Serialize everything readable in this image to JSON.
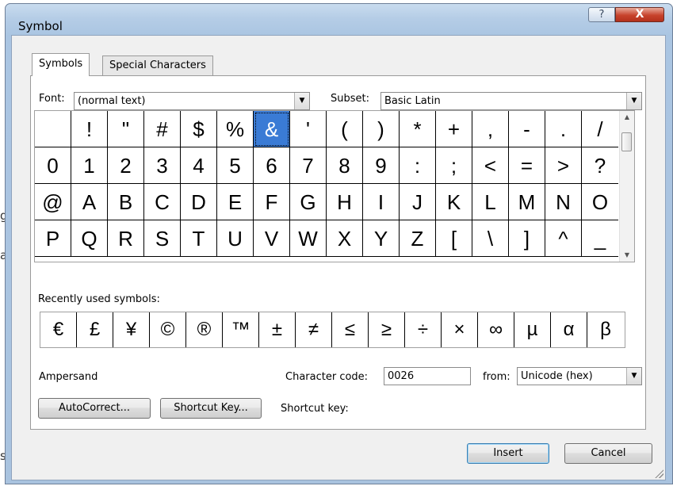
{
  "window": {
    "title": "Symbol",
    "help_glyph": "?",
    "close_glyph": "X"
  },
  "tabs": [
    {
      "label": "Symbols",
      "active": true
    },
    {
      "label": "Special Characters",
      "active": false
    }
  ],
  "font": {
    "label": "Font:",
    "value": "(normal text)"
  },
  "subset": {
    "label": "Subset:",
    "value": "Basic Latin"
  },
  "symbols": [
    "",
    "!",
    "\"",
    "#",
    "$",
    "%",
    "&",
    "'",
    "(",
    ")",
    "*",
    "+",
    ",",
    "-",
    ".",
    "/",
    "0",
    "1",
    "2",
    "3",
    "4",
    "5",
    "6",
    "7",
    "8",
    "9",
    ":",
    ";",
    "<",
    "=",
    ">",
    "?",
    "@",
    "A",
    "B",
    "C",
    "D",
    "E",
    "F",
    "G",
    "H",
    "I",
    "J",
    "K",
    "L",
    "M",
    "N",
    "O",
    "P",
    "Q",
    "R",
    "S",
    "T",
    "U",
    "V",
    "W",
    "X",
    "Y",
    "Z",
    "[",
    "\\",
    "]",
    "^",
    "_"
  ],
  "selected_symbol": "&",
  "recent": {
    "label": "Recently used symbols:",
    "symbols": [
      "€",
      "£",
      "¥",
      "©",
      "®",
      "™",
      "±",
      "≠",
      "≤",
      "≥",
      "÷",
      "×",
      "∞",
      "µ",
      "α",
      "β"
    ]
  },
  "character_name": "Ampersand",
  "character_code": {
    "label": "Character code:",
    "value": "0026"
  },
  "from": {
    "label": "from:",
    "value": "Unicode (hex)"
  },
  "buttons": {
    "autocorrect": "AutoCorrect...",
    "shortcut_key_button": "Shortcut Key...",
    "insert": "Insert",
    "cancel": "Cancel"
  },
  "shortcut_key_label": "Shortcut key:",
  "colors": {
    "selection": "#3a7bd5",
    "frame": "#aac5e2",
    "client": "#f0f0f0"
  }
}
